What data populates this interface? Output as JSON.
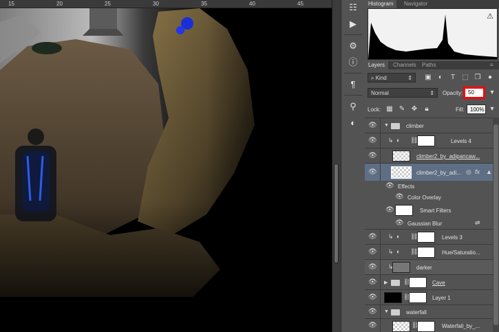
{
  "ruler": {
    "ticks": [
      "15",
      "20",
      "25",
      "30",
      "35",
      "40",
      "45"
    ]
  },
  "panels": {
    "histogram_tabs": [
      "Histogram",
      "Navigator"
    ],
    "layers_tabs": [
      "Layers",
      "Channels",
      "Paths"
    ],
    "filter_kind": "Kind",
    "blend_mode": "Normal",
    "opacity_label": "Opacity:",
    "opacity_value": "50",
    "lock_label": "Lock:",
    "fill_label": "Fill:",
    "fill_value": "100%"
  },
  "layers": [
    {
      "name": "climber",
      "type": "group"
    },
    {
      "name": "Levels 4",
      "type": "adjustment"
    },
    {
      "name": "climber2_by_adipancaw...",
      "type": "smart"
    },
    {
      "name": "climber2_by_adi...",
      "type": "smart",
      "selected": true,
      "fx": "fx"
    },
    {
      "name": "Effects",
      "type": "sub"
    },
    {
      "name": "Color Overlay",
      "type": "sub"
    },
    {
      "name": "Smart Filters",
      "type": "sub"
    },
    {
      "name": "Gaussian Blur",
      "type": "sub"
    },
    {
      "name": "Levels 3",
      "type": "adjustment"
    },
    {
      "name": "Hue/Saturatio...",
      "type": "adjustment"
    },
    {
      "name": "darker",
      "type": "layer"
    },
    {
      "name": "Cave",
      "type": "group"
    },
    {
      "name": "Layer 1",
      "type": "layer"
    },
    {
      "name": "waterfall",
      "type": "group"
    },
    {
      "name": "Waterfall_by_...",
      "type": "layer"
    }
  ],
  "colors": {
    "highlight": "#ff0000",
    "selection": "#5e6f85",
    "panel_bg": "#535353"
  }
}
